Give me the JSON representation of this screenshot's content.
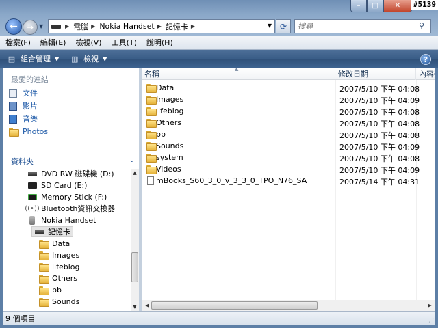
{
  "window": {
    "watermark": "#5139",
    "caption": {
      "minimize": "–",
      "maximize": "□",
      "close": "✕"
    }
  },
  "address_bar": {
    "breadcrumbs": [
      "電腦",
      "Nokia Handset",
      "記憶卡"
    ],
    "search_placeholder": "搜尋"
  },
  "menu": [
    "檔案(F)",
    "編輯(E)",
    "檢視(V)",
    "工具(T)",
    "說明(H)"
  ],
  "command_bar": {
    "organize": "組合管理",
    "views": "檢視"
  },
  "nav_pane": {
    "favorites_title": "最愛的連結",
    "favorites": [
      {
        "label": "文件",
        "icon": "documents-icon"
      },
      {
        "label": "影片",
        "icon": "pictures-icon"
      },
      {
        "label": "音樂",
        "icon": "music-icon"
      },
      {
        "label": "Photos",
        "icon": "folder-icon"
      }
    ],
    "folders_title": "資料夾",
    "tree": [
      {
        "label": "DVD RW 磁碟機 (D:)",
        "icon": "dvd-drive-icon",
        "indent": 1
      },
      {
        "label": "SD Card (E:)",
        "icon": "sd-card-icon",
        "indent": 1
      },
      {
        "label": "Memory Stick (F:)",
        "icon": "memory-stick-icon",
        "indent": 1
      },
      {
        "label": "Bluetooth資訊交換器",
        "icon": "bluetooth-icon",
        "indent": 1
      },
      {
        "label": "Nokia Handset",
        "icon": "phone-icon",
        "indent": 1
      },
      {
        "label": "記憶卡",
        "icon": "memory-card-icon",
        "indent": 2,
        "selected": true
      },
      {
        "label": "Data",
        "icon": "folder-icon",
        "indent": 3
      },
      {
        "label": "Images",
        "icon": "folder-icon",
        "indent": 3
      },
      {
        "label": "lifeblog",
        "icon": "folder-icon",
        "indent": 3
      },
      {
        "label": "Others",
        "icon": "folder-icon",
        "indent": 3
      },
      {
        "label": "pb",
        "icon": "folder-icon",
        "indent": 3
      },
      {
        "label": "Sounds",
        "icon": "folder-icon",
        "indent": 3
      }
    ]
  },
  "file_list": {
    "columns": {
      "name": "名稱",
      "modified": "修改日期",
      "type": "內容類"
    },
    "rows": [
      {
        "name": "Data",
        "date": "2007/5/10 下午 04:08",
        "kind": "folder"
      },
      {
        "name": "Images",
        "date": "2007/5/10 下午 04:09",
        "kind": "folder"
      },
      {
        "name": "lifeblog",
        "date": "2007/5/10 下午 04:08",
        "kind": "folder"
      },
      {
        "name": "Others",
        "date": "2007/5/10 下午 04:08",
        "kind": "folder"
      },
      {
        "name": "pb",
        "date": "2007/5/10 下午 04:08",
        "kind": "folder"
      },
      {
        "name": "Sounds",
        "date": "2007/5/10 下午 04:09",
        "kind": "folder"
      },
      {
        "name": "system",
        "date": "2007/5/10 下午 04:08",
        "kind": "folder"
      },
      {
        "name": "Videos",
        "date": "2007/5/10 下午 04:09",
        "kind": "folder"
      },
      {
        "name": "mBooks_S60_3_0_v_3_3_0_TPO_N76_SA",
        "date": "2007/5/14 下午 04:31",
        "kind": "file"
      }
    ]
  },
  "status_bar": {
    "text": "9 個項目"
  }
}
